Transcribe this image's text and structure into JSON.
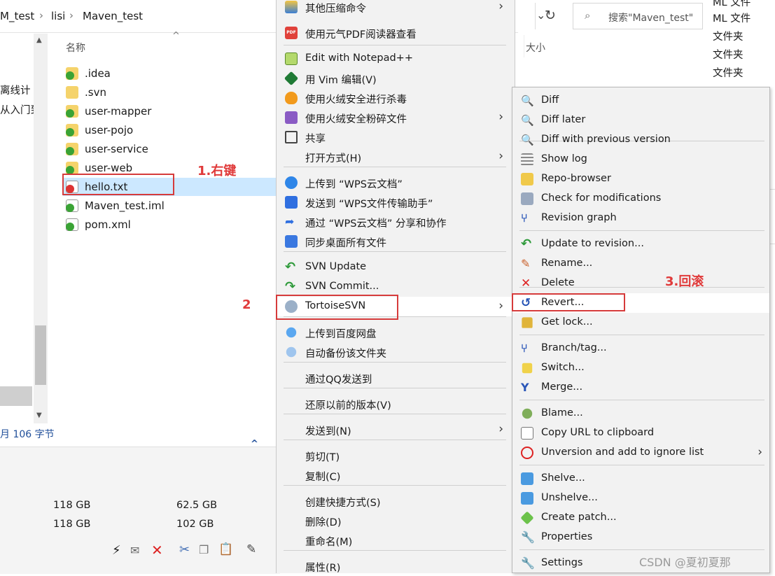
{
  "explorer": {
    "breadcrumb": [
      "M_test",
      "lisi",
      "Maven_test"
    ],
    "search_placeholder": "搜索\"Maven_test\"",
    "column_name": "名称",
    "column_size": "大小",
    "files": [
      {
        "name": ".idea",
        "icon": "folder-svn-ok-icon"
      },
      {
        "name": ".svn",
        "icon": "folder-icon"
      },
      {
        "name": "user-mapper",
        "icon": "folder-svn-ok-icon"
      },
      {
        "name": "user-pojo",
        "icon": "folder-svn-ok-icon"
      },
      {
        "name": "user-service",
        "icon": "folder-svn-ok-icon"
      },
      {
        "name": "user-web",
        "icon": "folder-svn-ok-icon"
      },
      {
        "name": "hello.txt",
        "icon": "file-svn-modified-icon"
      },
      {
        "name": "Maven_test.iml",
        "icon": "file-svn-ok-icon"
      },
      {
        "name": "pom.xml",
        "icon": "file-svn-ok-icon"
      }
    ],
    "nav_snippets": [
      "离线计",
      "从入门到"
    ],
    "status_text": "月 106 字节",
    "right_types": [
      "ML 文件",
      "ML 文件",
      "文件夹",
      "文件夹",
      "文件夹"
    ],
    "drives": [
      {
        "total": "118 GB",
        "free": "62.5 GB"
      },
      {
        "total": "118 GB",
        "free": "102 GB"
      }
    ]
  },
  "context_menu": {
    "items": [
      {
        "label": "其他压缩命令",
        "arrow": true,
        "icon": "archive-icon"
      },
      {
        "label": "使用元气PDF阅读器查看",
        "icon": "pdf-icon"
      },
      {
        "label": "Edit with Notepad++",
        "icon": "notepad-icon"
      },
      {
        "label": "用 Vim 编辑(V)",
        "icon": "vim-icon"
      },
      {
        "label": "使用火绒安全进行杀毒",
        "icon": "shield-icon"
      },
      {
        "label": "使用火绒安全粉碎文件",
        "arrow": true,
        "icon": "shredder-icon"
      },
      {
        "label": "共享",
        "icon": "share-icon"
      },
      {
        "label": "打开方式(H)",
        "arrow": true,
        "icon": ""
      },
      {
        "label": "上传到 “WPS云文档”",
        "icon": "cloud-upload-icon"
      },
      {
        "label": "发送到 “WPS文件传输助手”",
        "icon": "send-icon"
      },
      {
        "label": "通过 “WPS云文档” 分享和协作",
        "icon": "share-arrow-icon"
      },
      {
        "label": "同步桌面所有文件",
        "icon": "sync-icon"
      },
      {
        "label": "SVN Update",
        "icon": "svn-update-icon"
      },
      {
        "label": "SVN Commit...",
        "icon": "svn-commit-icon"
      },
      {
        "label": "TortoiseSVN",
        "arrow": true,
        "icon": "tortoise-icon"
      },
      {
        "label": "上传到百度网盘",
        "icon": "baidu-cloud-icon"
      },
      {
        "label": "自动备份该文件夹",
        "icon": "backup-icon"
      },
      {
        "label": "通过QQ发送到",
        "icon": ""
      },
      {
        "label": "还原以前的版本(V)",
        "icon": ""
      },
      {
        "label": "发送到(N)",
        "arrow": true,
        "icon": ""
      },
      {
        "label": "剪切(T)",
        "icon": ""
      },
      {
        "label": "复制(C)",
        "icon": ""
      },
      {
        "label": "创建快捷方式(S)",
        "icon": ""
      },
      {
        "label": "删除(D)",
        "icon": ""
      },
      {
        "label": "重命名(M)",
        "icon": ""
      },
      {
        "label": "属性(R)",
        "icon": ""
      }
    ]
  },
  "svn_submenu": {
    "items": [
      {
        "label": "Diff",
        "icon": "diff-icon"
      },
      {
        "label": "Diff later",
        "icon": "diff-later-icon"
      },
      {
        "label": "Diff with previous version",
        "icon": "diff-prev-icon"
      },
      {
        "label": "Show log",
        "icon": "log-icon"
      },
      {
        "label": "Repo-browser",
        "icon": "repo-browser-icon"
      },
      {
        "label": "Check for modifications",
        "icon": "check-modifications-icon"
      },
      {
        "label": "Revision graph",
        "icon": "revision-graph-icon"
      },
      {
        "label": "Update to revision...",
        "icon": "update-revision-icon"
      },
      {
        "label": "Rename...",
        "icon": "rename-icon"
      },
      {
        "label": "Delete",
        "icon": "delete-icon"
      },
      {
        "label": "Revert...",
        "icon": "revert-icon"
      },
      {
        "label": "Get lock...",
        "icon": "lock-icon"
      },
      {
        "label": "Branch/tag...",
        "icon": "branch-icon"
      },
      {
        "label": "Switch...",
        "icon": "switch-icon"
      },
      {
        "label": "Merge...",
        "icon": "merge-icon"
      },
      {
        "label": "Blame...",
        "icon": "blame-icon"
      },
      {
        "label": "Copy URL to clipboard",
        "icon": "copy-url-icon"
      },
      {
        "label": "Unversion and add to ignore list",
        "arrow": true,
        "icon": "ignore-icon"
      },
      {
        "label": "Shelve...",
        "icon": "shelve-icon"
      },
      {
        "label": "Unshelve...",
        "icon": "unshelve-icon"
      },
      {
        "label": "Create patch...",
        "icon": "patch-icon"
      },
      {
        "label": "Properties",
        "icon": "properties-icon"
      },
      {
        "label": "Settings",
        "icon": "settings-icon"
      }
    ]
  },
  "annotations": {
    "step1": "1.右键",
    "step2": "2",
    "step3": "3.回滚"
  },
  "watermark": "CSDN @夏初夏那",
  "colors": {
    "annotation_red": "#e03a3a",
    "selection_blue": "#cce8ff",
    "menu_bg": "#f2f2f2",
    "svn_green": "#3aa335"
  }
}
